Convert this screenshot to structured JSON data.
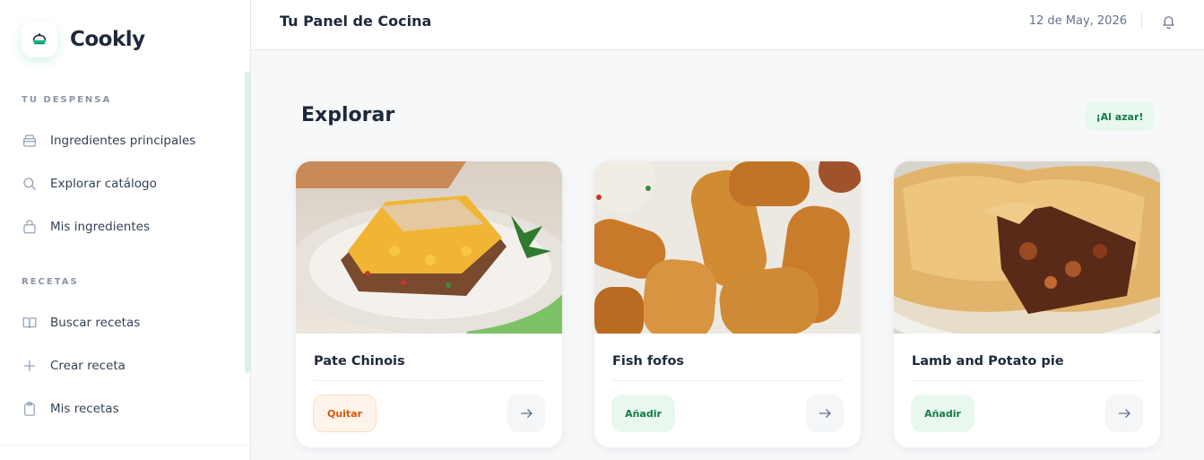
{
  "brand": {
    "name": "Cookly",
    "logo_icon": "cooking-pot-icon",
    "accent": "#10b981"
  },
  "sidebar": {
    "sections": [
      {
        "label": "TU DESPENSA",
        "items": [
          {
            "label": "Ingredientes principales",
            "icon": "basket-icon"
          },
          {
            "label": "Explorar catálogo",
            "icon": "search-icon"
          },
          {
            "label": "Mis ingredientes",
            "icon": "shopping-bag-icon"
          }
        ]
      },
      {
        "label": "RECETAS",
        "items": [
          {
            "label": "Buscar recetas",
            "icon": "book-open-icon"
          },
          {
            "label": "Crear receta",
            "icon": "plus-icon"
          },
          {
            "label": "Mis recetas",
            "icon": "clipboard-icon"
          }
        ]
      }
    ]
  },
  "header": {
    "title": "Tu Panel de Cocina",
    "date": "12 de May, 2026",
    "bell_icon": "bell-icon"
  },
  "main": {
    "title": "Explorar",
    "random_button": "¡Al azar!",
    "cards": [
      {
        "title": "Pate Chinois",
        "action": "Quitar",
        "action_state": "remove",
        "arrow_icon": "arrow-right-icon"
      },
      {
        "title": "Fish fofos",
        "action": "Añadir",
        "action_state": "add",
        "arrow_icon": "arrow-right-icon"
      },
      {
        "title": "Lamb and Potato pie",
        "action": "Añadir",
        "action_state": "add",
        "arrow_icon": "arrow-right-icon"
      }
    ]
  },
  "colors": {
    "remove_text": "#d9560a",
    "add_text": "#137a47",
    "add_bg": "#e8f8ee",
    "remove_bg": "#fff4e9"
  }
}
